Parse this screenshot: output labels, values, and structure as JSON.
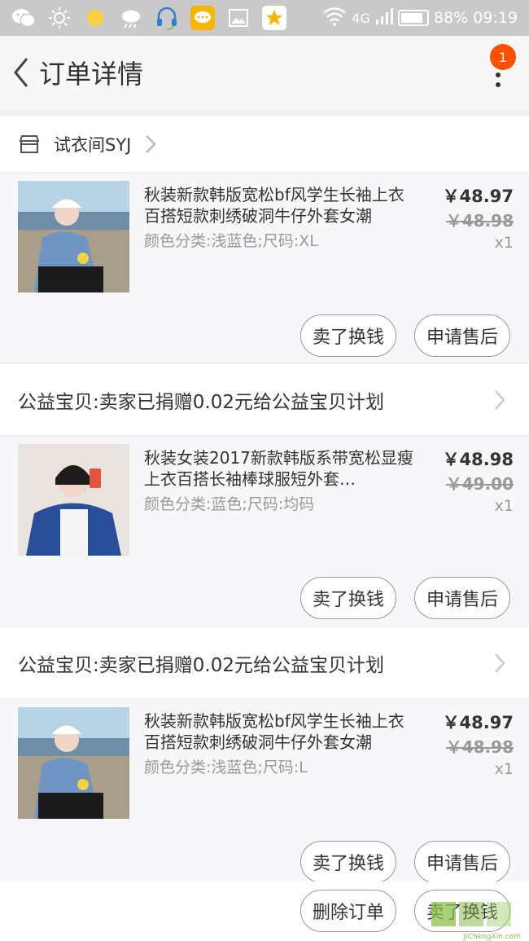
{
  "status_bar": {
    "network": "4G",
    "battery": "88%",
    "battery_level": 0.88,
    "time": "09:19"
  },
  "header": {
    "title": "订单详情",
    "badge_count": "1"
  },
  "shop": {
    "name": "试衣间SYJ"
  },
  "items": [
    {
      "title": "秋装新款韩版宽松bf风学生长袖上衣百搭短款刺绣破洞牛仔外套女潮",
      "sku": "颜色分类:浅蓝色;尺码:XL",
      "price": "￥48.97",
      "original_price": "￥48.98",
      "quantity": "x1",
      "buttons": [
        "卖了换钱",
        "申请售后"
      ]
    },
    {
      "title": "秋装女装2017新款韩版系带宽松显瘦上衣百搭长袖棒球服短外套…",
      "sku": "颜色分类:蓝色;尺码:均码",
      "price": "￥48.98",
      "original_price": "￥49.00",
      "quantity": "x1",
      "buttons": [
        "卖了换钱",
        "申请售后"
      ]
    },
    {
      "title": "秋装新款韩版宽松bf风学生长袖上衣百搭短款刺绣破洞牛仔外套女潮",
      "sku": "颜色分类:浅蓝色;尺码:L",
      "price": "￥48.97",
      "original_price": "￥48.98",
      "quantity": "x1",
      "buttons": [
        "卖了换钱",
        "申请售后"
      ]
    }
  ],
  "charity": [
    {
      "text": "公益宝贝:卖家已捐赠0.02元给公益宝贝计划"
    },
    {
      "text": "公益宝贝:卖家已捐赠0.02元给公益宝贝计划"
    }
  ],
  "bottom_bar": {
    "buttons": [
      "删除订单",
      "卖了换钱"
    ]
  },
  "watermark": {
    "text": "JiChengXin.com"
  },
  "colors": {
    "accent": "#ff5000",
    "status_bar": "#c9c9c9"
  }
}
